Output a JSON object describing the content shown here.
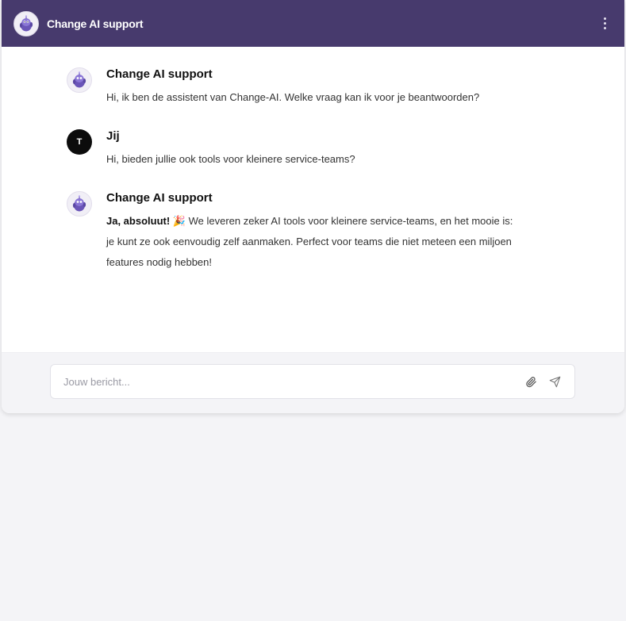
{
  "header": {
    "title": "Change AI support",
    "avatar_icon": "robot-mascot-icon",
    "menu_icon": "more-vertical-icon"
  },
  "messages": [
    {
      "sender": "Change AI support",
      "avatar": "robot-mascot-icon",
      "text": "Hi, ik ben de assistent van Change-AI. Welke vraag kan ik voor je beantwoorden?"
    },
    {
      "sender": "Jij",
      "avatar_initial": "T",
      "text": "Hi, bieden jullie ook tools voor kleinere service-teams?"
    },
    {
      "sender": "Change AI support",
      "avatar": "robot-mascot-icon",
      "bold_lead": "Ja, absoluut!",
      "emoji": "🎉",
      "line1": "We leveren zeker AI tools voor kleinere service-teams, en het mooie is:",
      "line2": "je kunt ze ook eenvoudig zelf aanmaken. Perfect voor teams die niet meteen een miljoen",
      "line3": "features nodig hebben!"
    }
  ],
  "composer": {
    "placeholder": "Jouw bericht...",
    "value": "",
    "attach_icon": "paperclip-icon",
    "send_icon": "send-icon"
  },
  "colors": {
    "header_bg": "#473a6d",
    "page_bg": "#f4f4f7",
    "user_avatar_bg": "#0c0c0c"
  }
}
